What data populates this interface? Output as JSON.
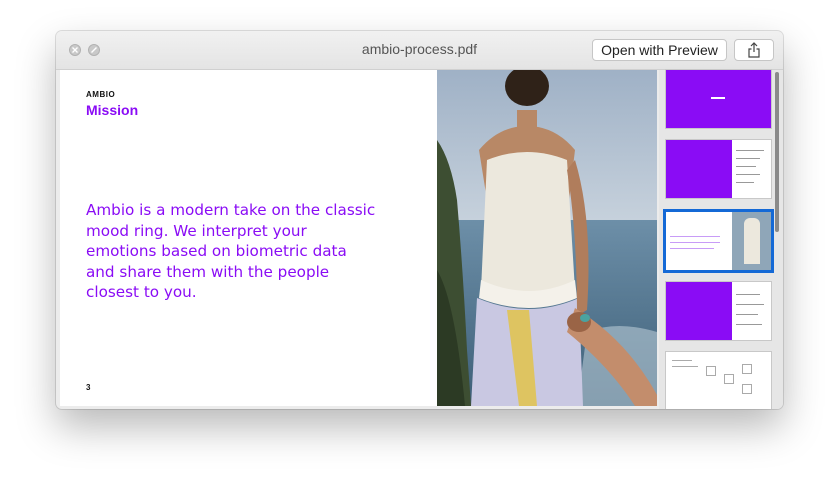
{
  "window": {
    "title": "ambio-process.pdf",
    "open_with_preview_label": "Open with Preview"
  },
  "slide": {
    "brand": "AMBIO",
    "heading": "Mission",
    "body": "Ambio is a modern take on the classic mood ring. We interpret your emotions based on biometric data and share them with the people closest to you.",
    "page_number": "3"
  },
  "thumbnails": [
    {
      "label": "thumbnail-page-1"
    },
    {
      "label": "thumbnail-page-2"
    },
    {
      "label": "thumbnail-page-3",
      "selected": true
    },
    {
      "label": "thumbnail-page-4"
    },
    {
      "label": "thumbnail-page-5"
    }
  ],
  "colors": {
    "accent": "#8a0cf5",
    "selection": "#1469d6"
  },
  "icons": [
    "close-icon",
    "minimize-icon",
    "share-icon"
  ]
}
